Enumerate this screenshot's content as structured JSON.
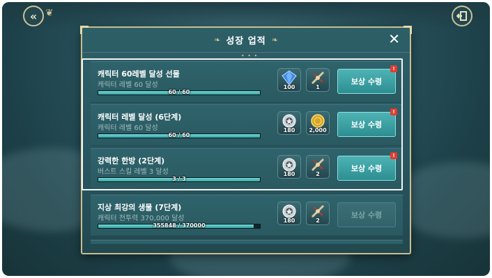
{
  "modal": {
    "title": "성장 업적",
    "close_label": "✕"
  },
  "achievements": [
    {
      "title": "캐릭터 60레벨 달성 선물",
      "subtitle": "캐릭터 레벨 60 달성",
      "progress_text": "60 / 60",
      "progress": 1.0,
      "rewards": [
        {
          "icon": "blue-gem-icon",
          "qty": "100"
        },
        {
          "icon": "scroll-icon",
          "qty": "1"
        }
      ],
      "button_label": "보상 수령",
      "badge": "!",
      "claimable": true
    },
    {
      "title": "캐릭터 레벨 달성 (6단계)",
      "subtitle": "캐릭터 레벨 60 달성",
      "progress_text": "60 / 60",
      "progress": 1.0,
      "rewards": [
        {
          "icon": "silver-medal-icon",
          "qty": "180"
        },
        {
          "icon": "gold-coin-icon",
          "qty": "2,000"
        }
      ],
      "button_label": "보상 수령",
      "badge": "!",
      "claimable": true
    },
    {
      "title": "강력한 한방 (2단계)",
      "subtitle": "버스트 스킬 레벨 3 달성",
      "progress_text": "3 / 3",
      "progress": 1.0,
      "rewards": [
        {
          "icon": "silver-medal-icon",
          "qty": "180"
        },
        {
          "icon": "scroll-icon",
          "qty": "2"
        }
      ],
      "button_label": "보상 수령",
      "badge": "!",
      "claimable": true
    },
    {
      "title": "지상 최강의 생물 (7단계)",
      "subtitle": "캐릭터 전투력 370,000 달성",
      "progress_text": "355848 / 370000",
      "progress": 0.9617,
      "rewards": [
        {
          "icon": "silver-medal-icon",
          "qty": "180"
        },
        {
          "icon": "scroll-icon",
          "qty": "2"
        }
      ],
      "button_label": "보상 수령",
      "badge": "",
      "claimable": false
    }
  ],
  "colors": {
    "accent": "#4fb3b5",
    "badge": "#e43b2f",
    "gold_frame": "#c9bf8f"
  }
}
